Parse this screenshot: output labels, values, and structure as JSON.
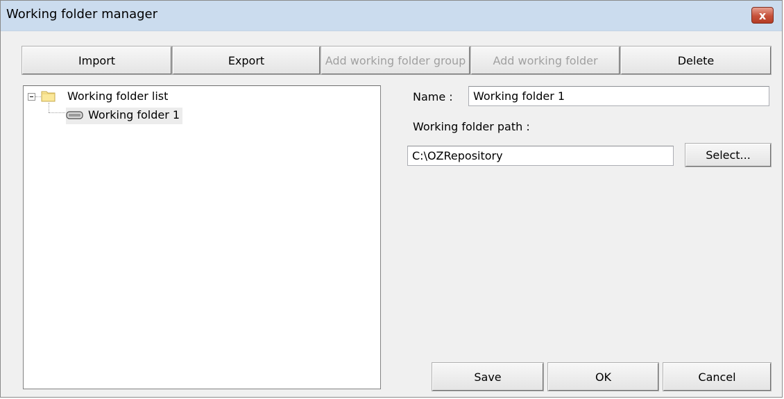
{
  "window": {
    "title": "Working folder manager",
    "close_label": "x"
  },
  "toolbar": {
    "import_label": "Import",
    "export_label": "Export",
    "add_group_label": "Add working folder group",
    "add_folder_label": "Add working folder",
    "delete_label": "Delete"
  },
  "tree": {
    "root_label": "Working folder list",
    "child_label": "Working folder 1"
  },
  "form": {
    "name_label": "Name :",
    "name_value": "Working folder 1",
    "path_label": "Working folder path :",
    "path_value": "C:\\OZRepository",
    "select_label": "Select..."
  },
  "footer": {
    "save_label": "Save",
    "ok_label": "OK",
    "cancel_label": "Cancel"
  }
}
